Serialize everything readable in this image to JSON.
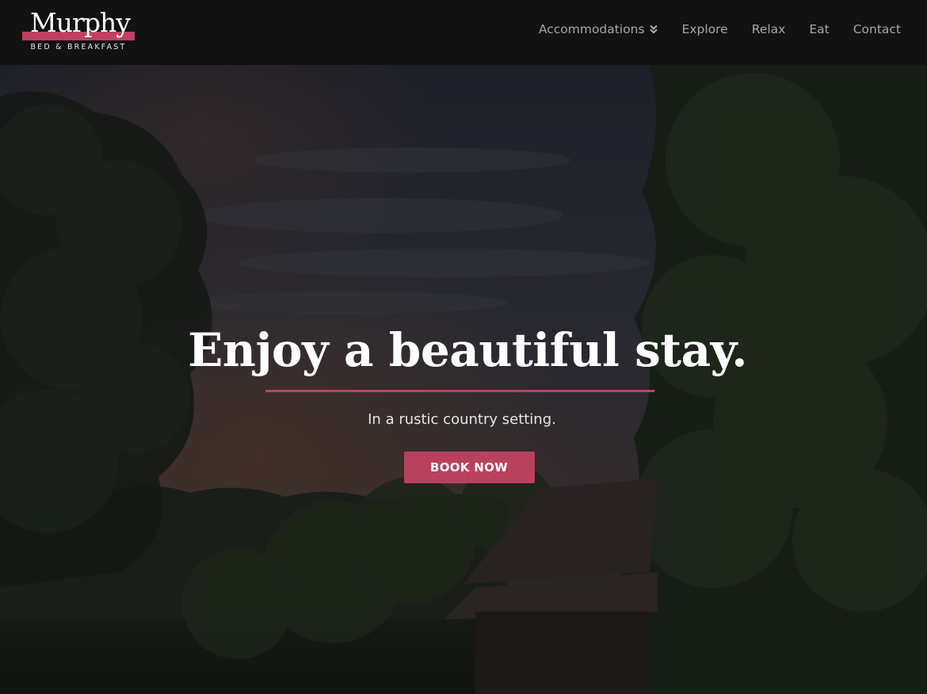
{
  "brand": {
    "name": "Murphy",
    "tagline": "BED & BREAKFAST",
    "accent_color": "#c0415f"
  },
  "nav": {
    "items": [
      {
        "label": "Accommodations",
        "icon": "double-chevron-down-icon"
      },
      {
        "label": "Explore"
      },
      {
        "label": "Relax"
      },
      {
        "label": "Eat"
      },
      {
        "label": "Contact"
      }
    ]
  },
  "hero": {
    "title": "Enjoy a beautiful stay.",
    "subtitle": "In a rustic country setting.",
    "cta_label": "BOOK NOW",
    "background": "dusk-forest-cabin-photo"
  }
}
